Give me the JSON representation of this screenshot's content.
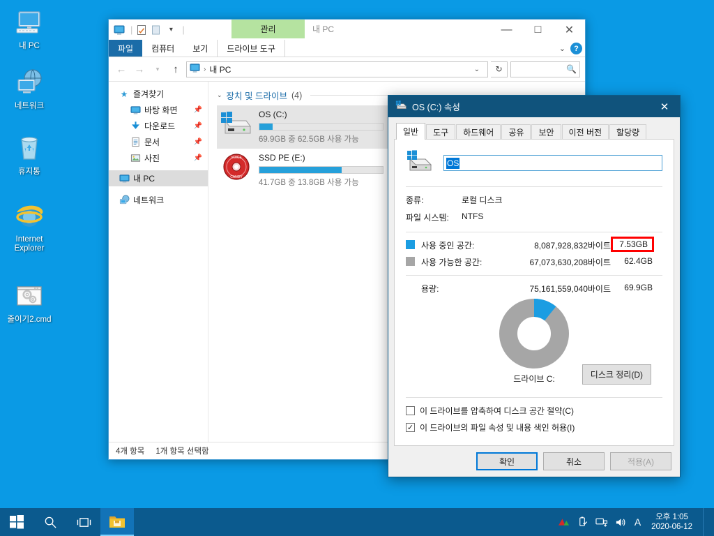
{
  "desktop": {
    "background_color": "#0a9ae5",
    "icons": [
      {
        "label": "내 PC",
        "icon": "this-pc-icon"
      },
      {
        "label": "네트워크",
        "icon": "network-icon"
      },
      {
        "label": "휴지통",
        "icon": "recycle-bin-icon"
      },
      {
        "label": "Internet Explorer",
        "icon": "internet-explorer-icon"
      },
      {
        "label": "줄이기2.cmd",
        "icon": "cmd-script-icon"
      }
    ]
  },
  "explorer": {
    "window_title": "내 PC",
    "contextual_tab_header": "관리",
    "quick_access_toolbar": [
      {
        "name": "this-pc-icon"
      },
      {
        "name": "properties-icon"
      },
      {
        "name": "new-folder-icon"
      },
      {
        "name": "customize-qat-icon"
      }
    ],
    "ribbon_tabs": [
      {
        "label": "파일",
        "active": true
      },
      {
        "label": "컴퓨터",
        "active": false
      },
      {
        "label": "보기",
        "active": false
      },
      {
        "label": "드라이브 도구",
        "active": false
      }
    ],
    "window_buttons": {
      "minimize": "—",
      "maximize": "□",
      "close": "✕",
      "collapse_ribbon": "⌄",
      "help": "?"
    },
    "address": {
      "crumb_root": "내 PC",
      "separator": "›",
      "dropdown": "⌄",
      "refresh": "↻"
    },
    "search": {
      "value": "",
      "placeholder": ""
    },
    "nav_pane": [
      {
        "label": "즐겨찾기",
        "icon": "star-icon",
        "level": 0,
        "pinned": false,
        "selected": false
      },
      {
        "label": "바탕 화면",
        "icon": "desktop-icon",
        "level": 1,
        "pinned": true,
        "selected": false
      },
      {
        "label": "다운로드",
        "icon": "downloads-icon",
        "level": 1,
        "pinned": true,
        "selected": false
      },
      {
        "label": "문서",
        "icon": "documents-icon",
        "level": 1,
        "pinned": true,
        "selected": false
      },
      {
        "label": "사진",
        "icon": "pictures-icon",
        "level": 1,
        "pinned": true,
        "selected": false
      },
      {
        "label": "내 PC",
        "icon": "this-pc-icon",
        "level": 0,
        "pinned": false,
        "selected": true
      },
      {
        "label": "네트워크",
        "icon": "network-icon",
        "level": 0,
        "pinned": false,
        "selected": false
      }
    ],
    "group": {
      "title": "장치 및 드라이브",
      "count": "(4)"
    },
    "drives": [
      {
        "name": "OS (C:)",
        "usage_text": "69.9GB 중 62.5GB 사용 가능",
        "used_percent": 10.8,
        "icon": "windows-drive-icon",
        "selected": true
      },
      {
        "name": "SSD PE (E:)",
        "usage_text": "41.7GB 중 13.8GB 사용 가능",
        "used_percent": 66.9,
        "icon": "cd-drive-icon",
        "selected": false
      }
    ],
    "status_bar": {
      "item_count": "4개 항목",
      "selection": "1개 항목 선택함"
    }
  },
  "properties_dialog": {
    "title": "OS (C:) 속성",
    "title_bar_color": "#10537c",
    "close_label": "✕",
    "tabs": [
      {
        "label": "일반",
        "active": true
      },
      {
        "label": "도구",
        "active": false
      },
      {
        "label": "하드웨어",
        "active": false
      },
      {
        "label": "공유",
        "active": false
      },
      {
        "label": "보안",
        "active": false
      },
      {
        "label": "이전 버전",
        "active": false
      },
      {
        "label": "할당량",
        "active": false
      }
    ],
    "volume_name": "OS",
    "fields": [
      {
        "key": "종류:",
        "value": "로컬 디스크"
      },
      {
        "key": "파일 시스템:",
        "value": "NTFS"
      }
    ],
    "space_rows": [
      {
        "label": "사용 중인 공간:",
        "bytes": "8,087,928,832바이트",
        "gb": "7.53GB",
        "swatch_color": "#1b9de2",
        "highlighted": true
      },
      {
        "label": "사용 가능한 공간:",
        "bytes": "67,073,630,208바이트",
        "gb": "62.4GB",
        "swatch_color": "#a6a6a6",
        "highlighted": false
      }
    ],
    "capacity": {
      "label": "용량:",
      "bytes": "75,161,559,040바이트",
      "gb": "69.9GB"
    },
    "donut": {
      "used_percent": 10.8,
      "used_color": "#1b9de2",
      "free_color": "#a6a6a6",
      "caption": "드라이브 C:"
    },
    "cleanup_button": "디스크 정리(D)",
    "checkboxes": [
      {
        "label": "이 드라이브를 압축하여 디스크 공간 절약(C)",
        "checked": false,
        "mark": ""
      },
      {
        "label": "이 드라이브의 파일 속성 및 내용 색인 허용(I)",
        "checked": true,
        "mark": "✓"
      }
    ],
    "buttons": [
      {
        "label": "확인",
        "style": "primary",
        "disabled": false
      },
      {
        "label": "취소",
        "style": "normal",
        "disabled": false
      },
      {
        "label": "적용(A)",
        "style": "normal",
        "disabled": true
      }
    ],
    "highlight_color": "#ff0000"
  },
  "taskbar": {
    "background_color": "#0b5a8e",
    "buttons": [
      {
        "name": "start-button",
        "active": false
      },
      {
        "name": "search-button",
        "active": false
      },
      {
        "name": "task-view-button",
        "active": false
      },
      {
        "name": "file-explorer-taskbar-button",
        "active": true
      }
    ],
    "tray_icons": [
      {
        "name": "nvidia-icon"
      },
      {
        "name": "usb-eject-icon"
      },
      {
        "name": "network-tray-icon"
      },
      {
        "name": "volume-icon"
      },
      {
        "name": "ime-mode-icon",
        "glyph": "A"
      }
    ],
    "clock": {
      "time": "오후 1:05",
      "date": "2020-06-12"
    }
  }
}
